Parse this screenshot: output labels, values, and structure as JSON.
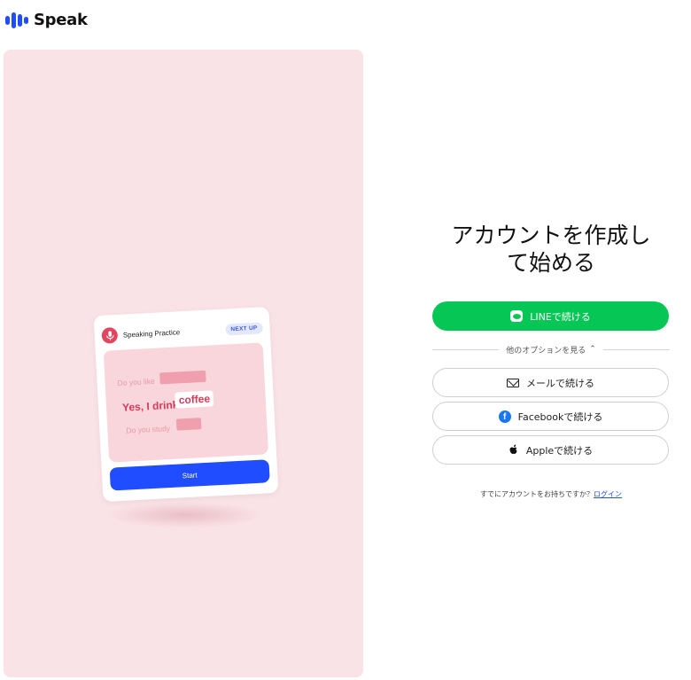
{
  "brand": {
    "name": "Speak",
    "color": "#1f4dff"
  },
  "hero": {
    "card": {
      "title": "Speaking Practice",
      "badge": "NEXT UP",
      "line1": "Do you like",
      "line2_text": "Yes, I drink",
      "line2_word": "coffee",
      "line3": "Do you study",
      "start_label": "Start"
    }
  },
  "auth": {
    "heading_line1": "アカウントを作成し",
    "heading_line2": "て始める",
    "line_button": "LINEで続ける",
    "more_options": "他のオプションを見る",
    "email_button": "メールで続ける",
    "facebook_button": "Facebookで続ける",
    "apple_button": "Appleで続ける",
    "login_prompt": "すでにアカウントをお持ちですか？",
    "login_link": "ログイン"
  },
  "colors": {
    "line_green": "#06c755",
    "hero_bg": "#fae3e7",
    "accent_pink": "#d83a58",
    "facebook_blue": "#1877f2"
  },
  "icons": [
    "speak-logo-icon",
    "microphone-icon",
    "line-icon",
    "chevron-up-icon",
    "mail-icon",
    "facebook-icon",
    "apple-icon"
  ]
}
